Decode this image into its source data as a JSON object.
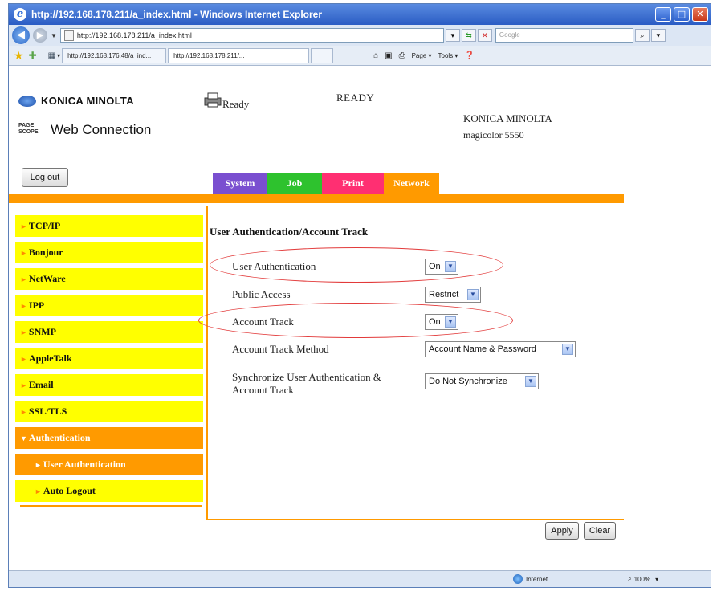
{
  "window": {
    "title": "http://192.168.178.211/a_index.html - Windows Internet Explorer",
    "min_glyph": "_",
    "max_glyph": "□",
    "close_glyph": "✕"
  },
  "browser": {
    "address": "http://192.168.178.211/a_index.html",
    "search_placeholder": "Google",
    "tabs": [
      "http://192.168.176.48/a_ind...",
      "http://192.168.178.211/..."
    ],
    "tools": [
      "Page ▾",
      "Tools ▾"
    ],
    "status_zone": "Internet",
    "zoom": "100%"
  },
  "header": {
    "brand": "KONICA MINOLTA",
    "pagescope_badge": "PAGE SCOPE",
    "product": "Web Connection",
    "status_icon_label": "Ready",
    "status_text": "READY",
    "model_vendor": "KONICA MINOLTA",
    "model_name": "magicolor 5550",
    "logout_label": "Log out"
  },
  "topnav": {
    "system": "System",
    "job": "Job",
    "print": "Print",
    "network": "Network"
  },
  "sidebar": {
    "items": [
      {
        "label": "TCP/IP"
      },
      {
        "label": "Bonjour"
      },
      {
        "label": "NetWare"
      },
      {
        "label": "IPP"
      },
      {
        "label": "SNMP"
      },
      {
        "label": "AppleTalk"
      },
      {
        "label": "Email"
      },
      {
        "label": "SSL/TLS"
      },
      {
        "label": "Authentication"
      },
      {
        "label": "User Authentication"
      },
      {
        "label": "Auto Logout"
      }
    ]
  },
  "content": {
    "title": "User Authentication/Account Track",
    "fields": [
      {
        "label": "User Authentication",
        "value": "On"
      },
      {
        "label": "Public Access",
        "value": "Restrict"
      },
      {
        "label": "Account Track",
        "value": "On"
      },
      {
        "label": "Account Track Method",
        "value": "Account Name & Password"
      },
      {
        "label": "Synchronize User Authentication & Account Track",
        "value": "Do Not Synchronize"
      }
    ],
    "apply_label": "Apply",
    "clear_label": "Clear"
  },
  "colors": {
    "system": "#7a4fd0",
    "job": "#2ec22e",
    "print": "#ff2f72",
    "network": "#ff9a00",
    "sidebar_item": "#ffff00",
    "highlight_ellipse": "#e23a3a"
  }
}
